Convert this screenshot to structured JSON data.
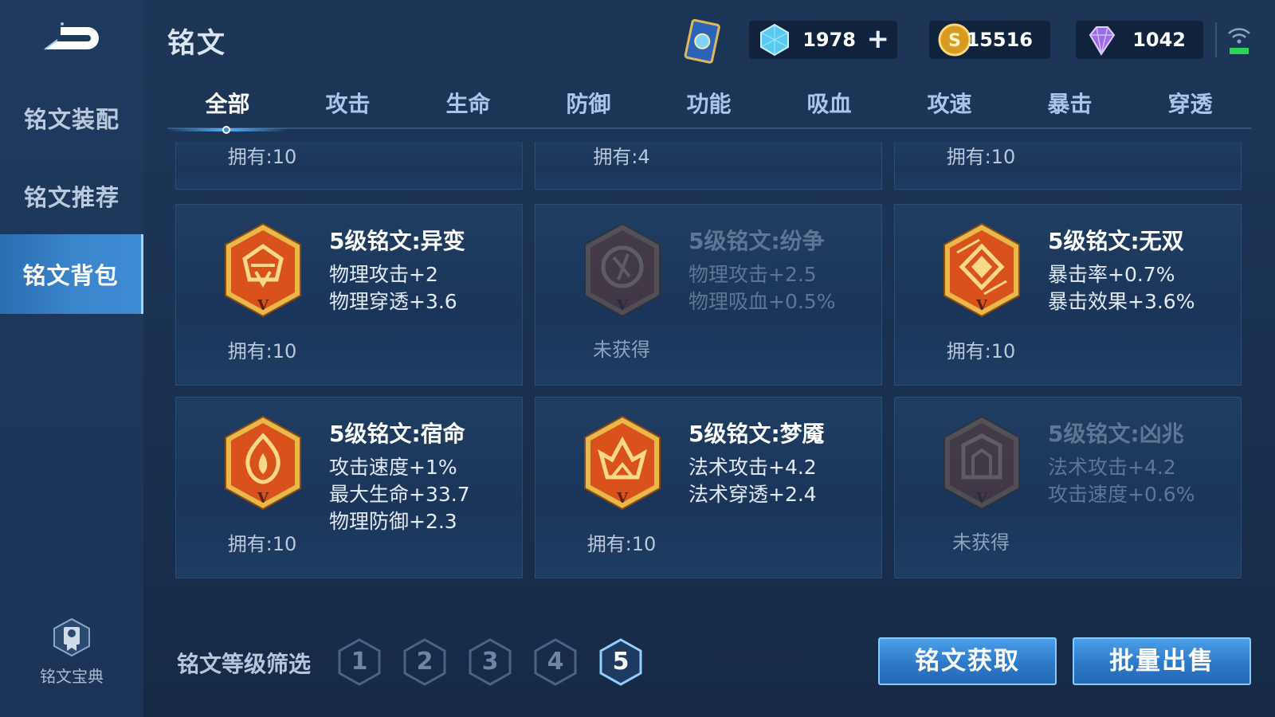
{
  "header": {
    "title": "铭文",
    "resources": [
      {
        "name": "crystal",
        "icon": "crystal-icon",
        "value": "1978",
        "plus": "+"
      },
      {
        "name": "gold",
        "icon": "gold-coin-icon",
        "value": "15516"
      },
      {
        "name": "diamond",
        "icon": "diamond-icon",
        "value": "1042"
      }
    ]
  },
  "sidebar": {
    "items": [
      {
        "label": "铭文装配"
      },
      {
        "label": "铭文推荐"
      },
      {
        "label": "铭文背包",
        "active": true
      }
    ],
    "codex_label": "铭文宝典"
  },
  "tabs": [
    {
      "label": "全部",
      "active": true
    },
    {
      "label": "攻击"
    },
    {
      "label": "生命"
    },
    {
      "label": "防御"
    },
    {
      "label": "功能"
    },
    {
      "label": "吸血"
    },
    {
      "label": "攻速"
    },
    {
      "label": "暴击"
    },
    {
      "label": "穿透"
    }
  ],
  "partial_row": [
    {
      "owned": "拥有:10"
    },
    {
      "owned": "拥有:4"
    },
    {
      "owned": "拥有:10"
    }
  ],
  "runes": [
    {
      "title": "5级铭文:异变",
      "stats": [
        "物理攻击+2",
        "物理穿透+3.6"
      ],
      "owned": "拥有:10",
      "locked": false
    },
    {
      "title": "5级铭文:纷争",
      "stats": [
        "物理攻击+2.5",
        "物理吸血+0.5%"
      ],
      "owned": "未获得",
      "locked": true
    },
    {
      "title": "5级铭文:无双",
      "stats": [
        "暴击率+0.7%",
        "暴击效果+3.6%"
      ],
      "owned": "拥有:10",
      "locked": false
    },
    {
      "title": "5级铭文:宿命",
      "stats": [
        "攻击速度+1%",
        "最大生命+33.7",
        "物理防御+2.3"
      ],
      "owned": "拥有:10",
      "locked": false
    },
    {
      "title": "5级铭文:梦魇",
      "stats": [
        "法术攻击+4.2",
        "法术穿透+2.4"
      ],
      "owned": "拥有:10",
      "locked": false
    },
    {
      "title": "5级铭文:凶兆",
      "stats": [
        "法术攻击+4.2",
        "攻击速度+0.6%"
      ],
      "owned": "未获得",
      "locked": true
    }
  ],
  "filter": {
    "label": "铭文等级筛选",
    "levels": [
      "1",
      "2",
      "3",
      "4",
      "5"
    ],
    "selected": "5"
  },
  "actions": {
    "obtain_label": "铭文获取",
    "sell_label": "批量出售"
  },
  "colors": {
    "accent": "#3b86cc",
    "rune_orange": "#d9521c",
    "rune_gold": "#e9b84a"
  }
}
